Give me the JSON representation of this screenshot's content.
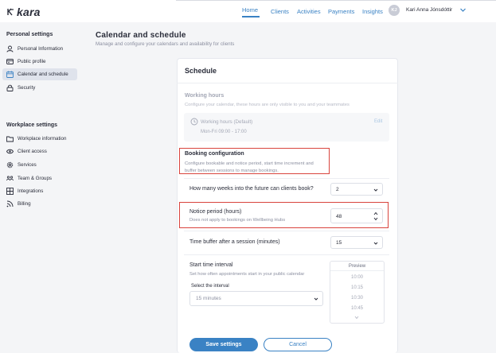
{
  "app": {
    "name": "kara"
  },
  "nav": {
    "items": [
      {
        "label": "Home",
        "active": true
      },
      {
        "label": "Clients"
      },
      {
        "label": "Activities"
      },
      {
        "label": "Payments"
      },
      {
        "label": "Insights"
      }
    ],
    "user": {
      "initials": "KJ",
      "name": "Kari Anna Jónsdóttir"
    }
  },
  "sidebar": {
    "personal_heading": "Personal settings",
    "personal_items": [
      {
        "label": "Personal Information",
        "icon": "user-icon"
      },
      {
        "label": "Public profile",
        "icon": "id-card-icon"
      },
      {
        "label": "Calendar and schedule",
        "icon": "calendar-icon",
        "active": true
      },
      {
        "label": "Security",
        "icon": "lock-icon"
      }
    ],
    "workplace_heading": "Workplace settings",
    "workplace_items": [
      {
        "label": "Workplace information",
        "icon": "folder-icon"
      },
      {
        "label": "Client access",
        "icon": "eye-icon"
      },
      {
        "label": "Services",
        "icon": "gear-icon"
      },
      {
        "label": "Team & Groups",
        "icon": "team-icon"
      },
      {
        "label": "Integrations",
        "icon": "integrations-icon"
      },
      {
        "label": "Billing",
        "icon": "rss-icon"
      }
    ]
  },
  "page": {
    "title": "Calendar and schedule",
    "subtitle": "Manage and configure your calendars and availability for clients"
  },
  "schedule": {
    "title": "Schedule",
    "working_hours": {
      "title": "Working hours",
      "subtitle": "Configure your calendar, these hours are only visible to you and your teammates",
      "entry_name": "Working hours (Default)",
      "entry_hours": "Mon-Fri  09:00 - 17:00",
      "edit_label": "Edit"
    },
    "booking": {
      "title": "Booking configuration",
      "subtitle": "Configure bookable and notice period, start time increment and buffer between sessions to manage bookings."
    },
    "weeks": {
      "label": "How many weeks into the future can clients book?",
      "value": "2"
    },
    "notice": {
      "label": "Notice period (hours)",
      "hint": "Does not apply to bookings on Wellbeing Hubs",
      "value": "48"
    },
    "buffer": {
      "label": "Time buffer after a session (minutes)",
      "value": "15"
    },
    "interval": {
      "title": "Start time interval",
      "subtitle": "Set how often appointments start in your public calendar",
      "select_label": "Select the interval",
      "value": "15 minutes"
    },
    "preview": {
      "title": "Preview",
      "times": [
        "10:00",
        "10:15",
        "10:30",
        "10:45"
      ]
    },
    "save_label": "Save settings",
    "cancel_label": "Cancel"
  },
  "colors": {
    "accent": "#3a82c4",
    "highlight": "#d9443d",
    "active_sidebar": "#dfe3ec"
  }
}
